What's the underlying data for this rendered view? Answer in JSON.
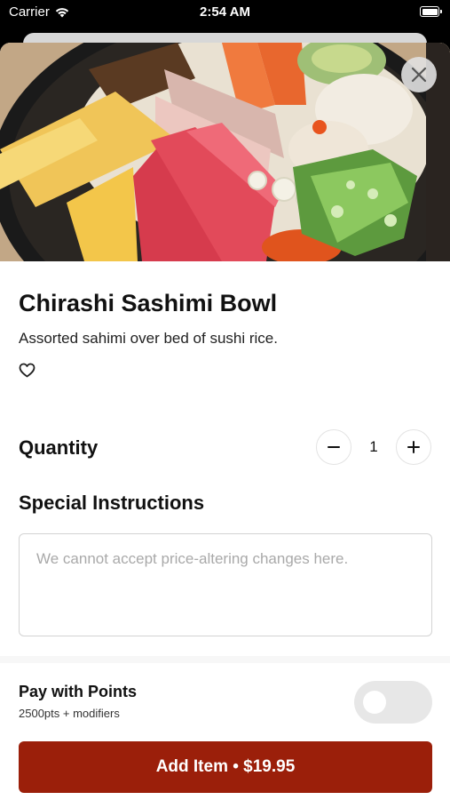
{
  "status": {
    "carrier": "Carrier",
    "time": "2:54 AM"
  },
  "item": {
    "title": "Chirashi Sashimi Bowl",
    "description": "Assorted sahimi over bed of sushi rice.",
    "image_alt": "chirashi-bowl-photo"
  },
  "quantity": {
    "label": "Quantity",
    "value": "1",
    "decrement_icon": "minus-icon",
    "increment_icon": "plus-icon"
  },
  "special_instructions": {
    "label": "Special Instructions",
    "value": "",
    "placeholder": "We cannot accept price-altering changes here."
  },
  "points": {
    "title": "Pay with Points",
    "subtitle": "2500pts + modifiers",
    "enabled": false
  },
  "cta": {
    "label": "Add Item • $19.95"
  },
  "colors": {
    "accent": "#9b1f0a",
    "toggle_off": "#e7e7e7"
  },
  "icons": {
    "close": "close-icon",
    "favorite": "heart-icon",
    "wifi": "wifi-icon",
    "battery": "battery-icon"
  }
}
